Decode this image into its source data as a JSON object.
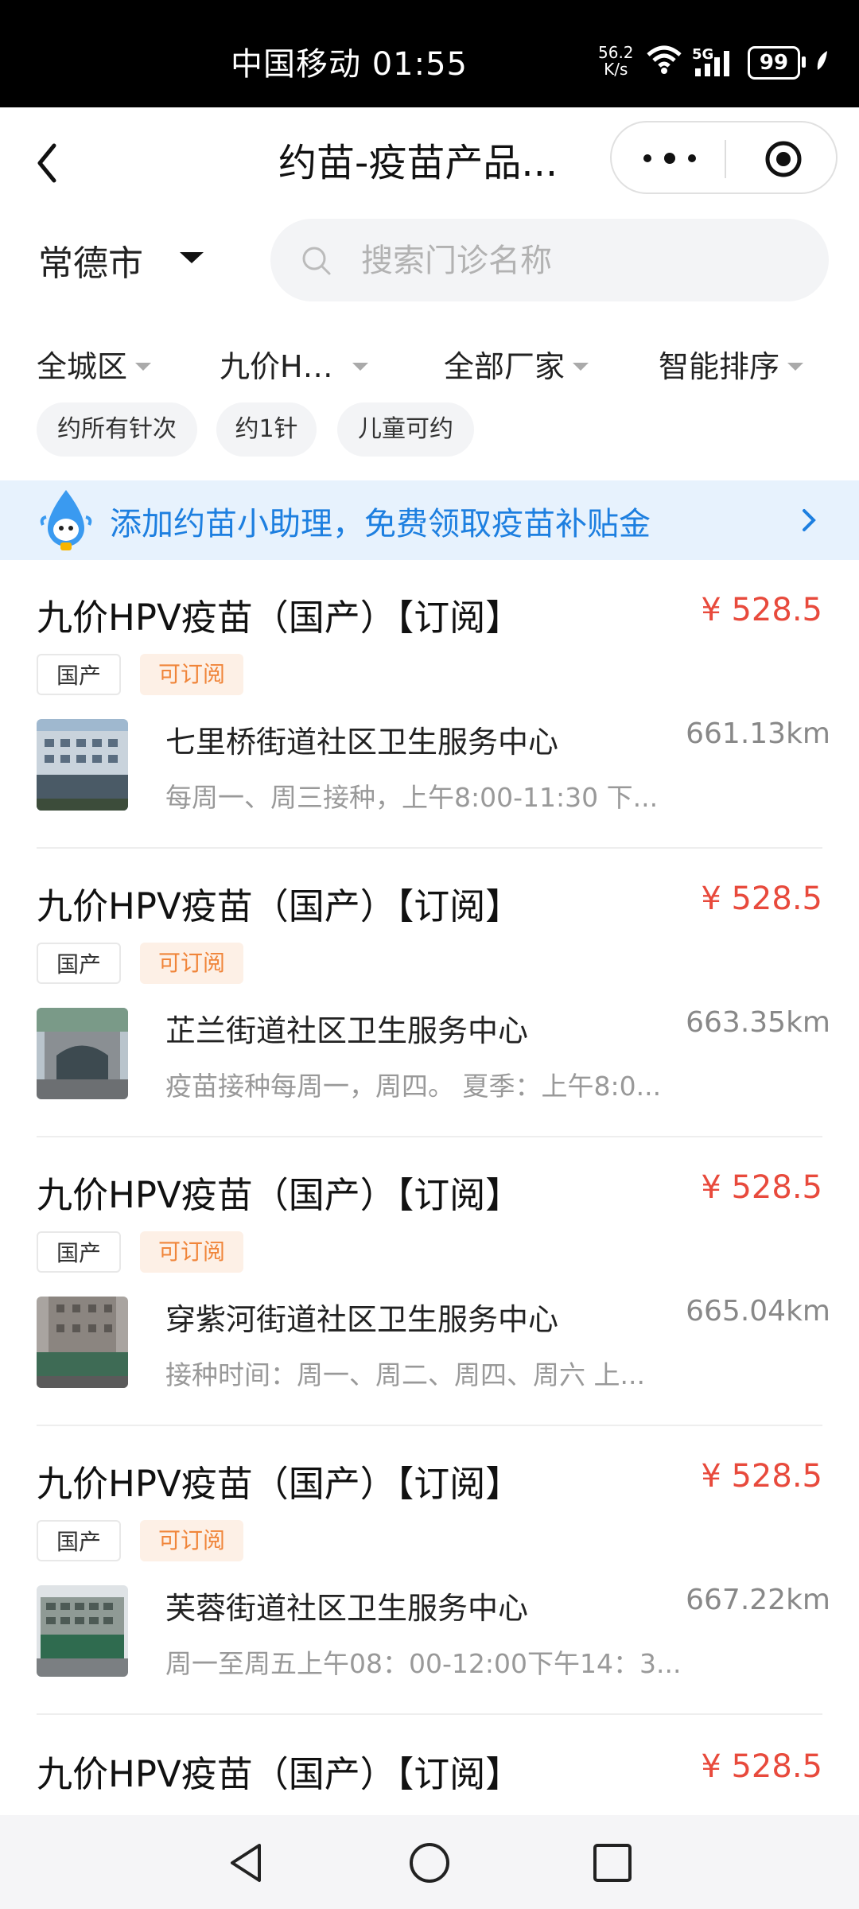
{
  "status_bar": {
    "carrier_time": "中国移动 01:55",
    "net_speed_value": "56.2",
    "net_speed_unit": "K/s",
    "network_type": "5G",
    "battery": "99"
  },
  "nav": {
    "title": "约苗-疫苗产品..."
  },
  "location": {
    "city": "常德市"
  },
  "search": {
    "placeholder": "搜索门诊名称"
  },
  "filters": [
    {
      "label": "全城区"
    },
    {
      "label": "九价H…"
    },
    {
      "label": "全部厂家"
    },
    {
      "label": "智能排序"
    }
  ],
  "chips": [
    {
      "label": "约所有针次"
    },
    {
      "label": "约1针"
    },
    {
      "label": "儿童可约"
    }
  ],
  "banner": {
    "text": "添加约苗小助理，免费领取疫苗补贴金"
  },
  "listings": [
    {
      "title": "九价HPV疫苗（国产）【订阅】",
      "price": "¥ 528.5",
      "tags": [
        "国产",
        "可订阅"
      ],
      "clinic": "七里桥街道社区卫生服务中心",
      "distance": "661.13km",
      "hours": "每周一、周三接种，上午8:00-11:30 下..."
    },
    {
      "title": "九价HPV疫苗（国产）【订阅】",
      "price": "¥ 528.5",
      "tags": [
        "国产",
        "可订阅"
      ],
      "clinic": "芷兰街道社区卫生服务中心",
      "distance": "663.35km",
      "hours": "疫苗接种每周一，周四。 夏季：上午8:0..."
    },
    {
      "title": "九价HPV疫苗（国产）【订阅】",
      "price": "¥ 528.5",
      "tags": [
        "国产",
        "可订阅"
      ],
      "clinic": "穿紫河街道社区卫生服务中心",
      "distance": "665.04km",
      "hours": "接种时间：周一、周二、周四、周六 上..."
    },
    {
      "title": "九价HPV疫苗（国产）【订阅】",
      "price": "¥ 528.5",
      "tags": [
        "国产",
        "可订阅"
      ],
      "clinic": "芙蓉街道社区卫生服务中心",
      "distance": "667.22km",
      "hours": "周一至周五上午08：00-12:00下午14：3..."
    },
    {
      "title": "九价HPV疫苗（国产）【订阅】",
      "price": "¥ 528.5"
    }
  ],
  "colors": {
    "price": "#e84a3c",
    "banner_bg": "#e7f2fd",
    "banner_text": "#1d7fe0",
    "subscribe_tag_bg": "#fdf0e6",
    "subscribe_tag_text": "#f0853a"
  },
  "icons": [
    "back-icon",
    "more-icon",
    "target-icon",
    "dropdown-icon",
    "search-icon",
    "mascot-icon",
    "chevron-right-icon",
    "nav-back-icon",
    "nav-home-icon",
    "nav-recents-icon"
  ]
}
